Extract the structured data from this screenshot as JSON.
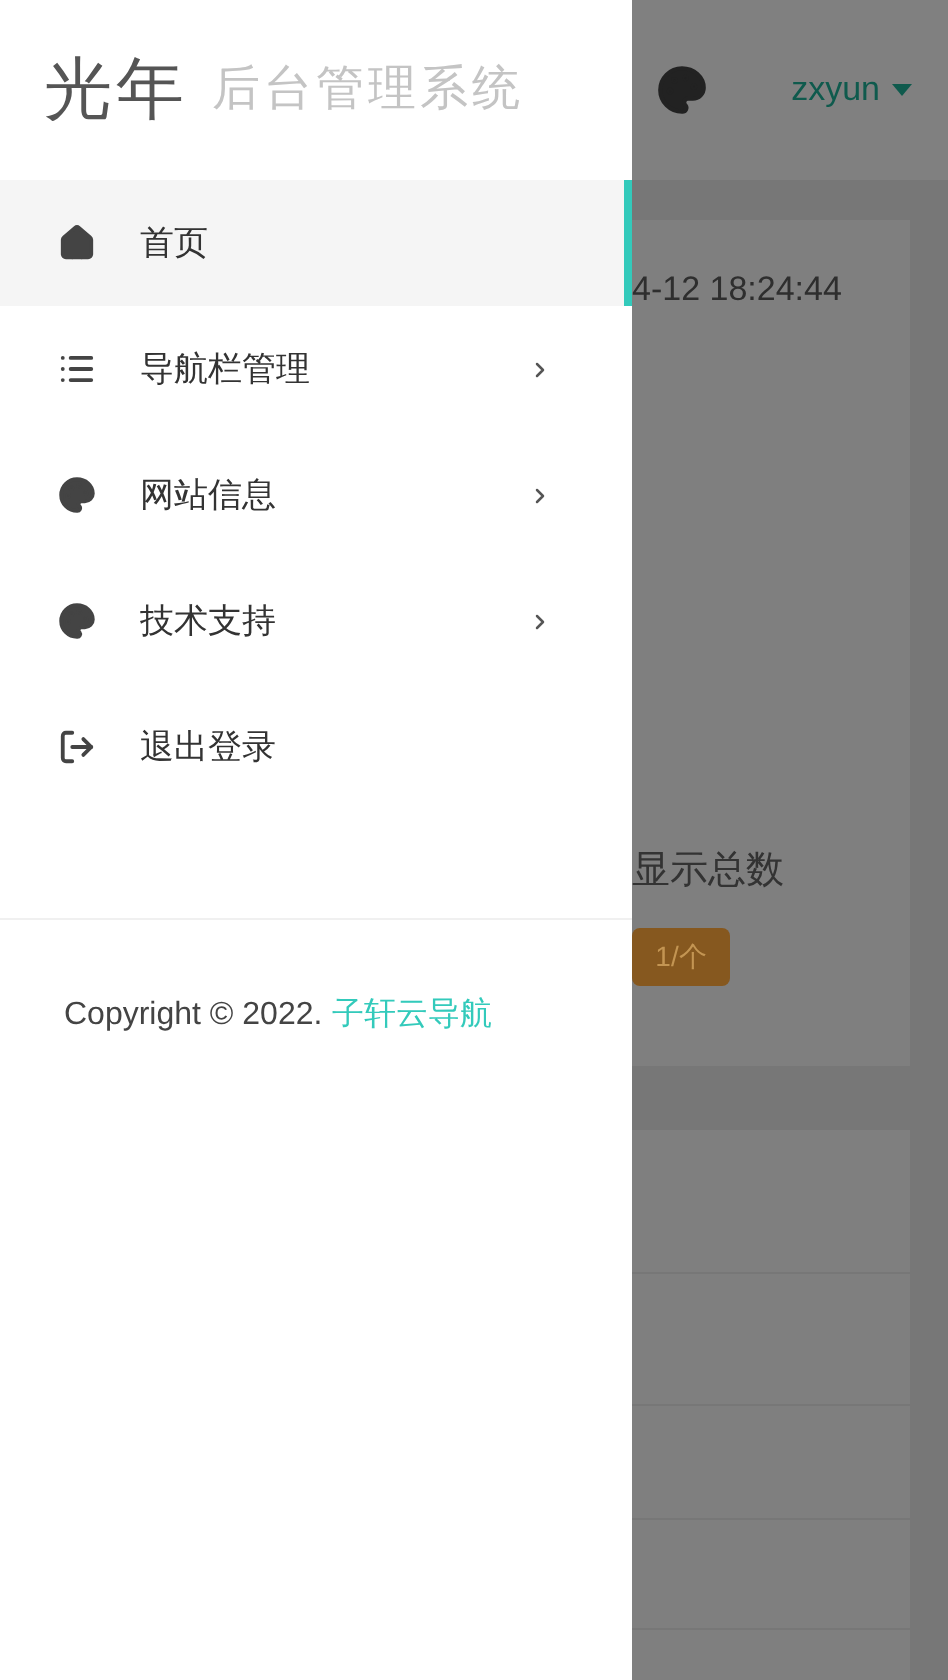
{
  "drawer": {
    "logo": {
      "mark": "光年",
      "title": "后台管理系统"
    },
    "menu": [
      {
        "label": "首页",
        "selected": true,
        "has_submenu": false
      },
      {
        "label": "导航栏管理",
        "selected": false,
        "has_submenu": true
      },
      {
        "label": "网站信息",
        "selected": false,
        "has_submenu": true
      },
      {
        "label": "技术支持",
        "selected": false,
        "has_submenu": true
      },
      {
        "label": "退出登录",
        "selected": false,
        "has_submenu": false
      }
    ],
    "footer": {
      "text": "Copyright © 2022.",
      "link": "子轩云导航"
    }
  },
  "page": {
    "user": "zxyun",
    "time": "4-12 18:24:44",
    "stat_label": "显示总数",
    "stat_badge": "1/个"
  }
}
